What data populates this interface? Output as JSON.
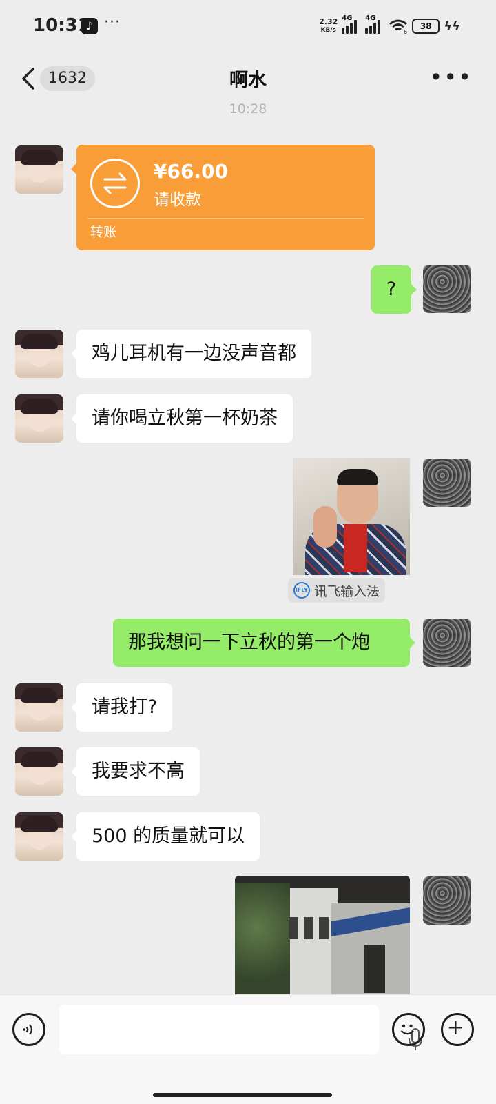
{
  "status_bar": {
    "time": "10:31",
    "dots": "···",
    "speed_value": "2.32",
    "speed_unit": "KB/s",
    "signal1_label": "4G",
    "signal2_label": "4G",
    "wifi_badge": "6",
    "battery": "38",
    "icons": [
      "tiktok-icon",
      "signal-icon",
      "signal-icon",
      "wifi-icon",
      "battery-icon",
      "charging-icon"
    ]
  },
  "header": {
    "unread_count": "1632",
    "title": "啊水"
  },
  "timestamp": "10:28",
  "transfer": {
    "amount": "¥66.00",
    "status": "请收款",
    "label": "转账",
    "color": "#f99d39"
  },
  "messages": [
    {
      "side": "right",
      "text": "?"
    },
    {
      "side": "left",
      "text": "鸡儿耳机有一边没声音都"
    },
    {
      "side": "left",
      "text": "请你喝立秋第一杯奶茶"
    },
    {
      "side": "right",
      "type": "sticker",
      "source_chip": "讯飞输入法",
      "chip_logo": "iFLY"
    },
    {
      "side": "right",
      "text": "那我想问一下立秋的第一个炮"
    },
    {
      "side": "left",
      "text": "请我打?"
    },
    {
      "side": "left",
      "text": "我要求不高"
    },
    {
      "side": "left",
      "text": "500 的质量就可以"
    },
    {
      "side": "right",
      "type": "photo"
    }
  ],
  "colors": {
    "background": "#ededed",
    "bubble_self": "#95ec69",
    "bubble_other": "#ffffff"
  }
}
